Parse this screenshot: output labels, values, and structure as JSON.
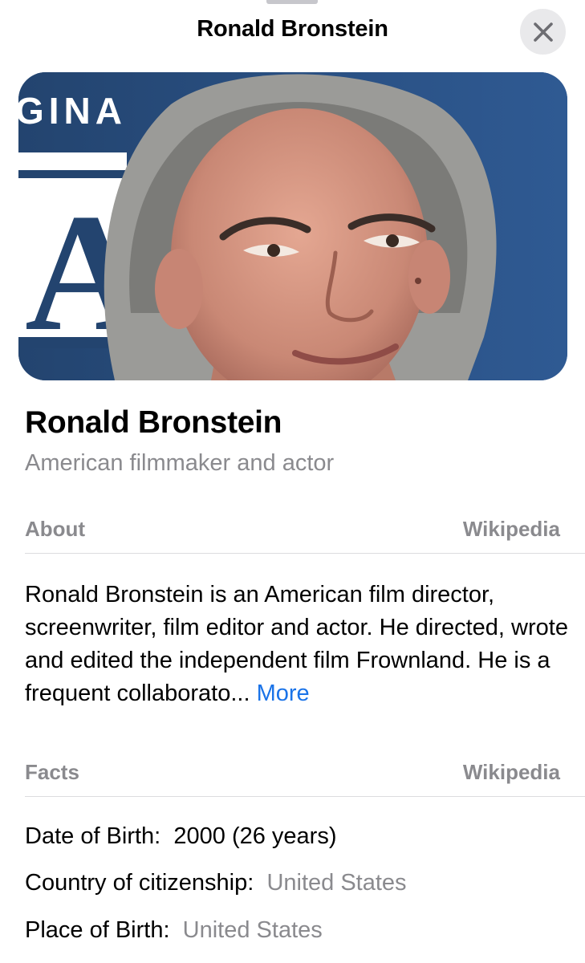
{
  "header": {
    "title": "Ronald Bronstein",
    "close_icon": "close-icon"
  },
  "hero": {
    "sign_text": "GINA",
    "sign_letter": "A",
    "colors": {
      "backdrop": "#2e5186",
      "sign": "#ffffff"
    }
  },
  "person": {
    "name": "Ronald Bronstein",
    "subtitle": "American filmmaker and actor"
  },
  "about": {
    "label": "About",
    "source": "Wikipedia",
    "text": "Ronald Bronstein is an American film director, screenwriter, film editor and actor. He directed, wrote and edited the independent film Frownland. He is a frequent collaborato...",
    "more_label": "More"
  },
  "facts": {
    "label": "Facts",
    "source": "Wikipedia",
    "items": [
      {
        "label": "Date of Birth:",
        "value": "2000 (26 years)"
      },
      {
        "label": "Country of citizenship:",
        "value": "United States"
      },
      {
        "label": "Place of Birth:",
        "value": "United States"
      }
    ]
  },
  "colors": {
    "link_blue": "#1a73e8",
    "secondary_grey": "#8a8a8e"
  }
}
